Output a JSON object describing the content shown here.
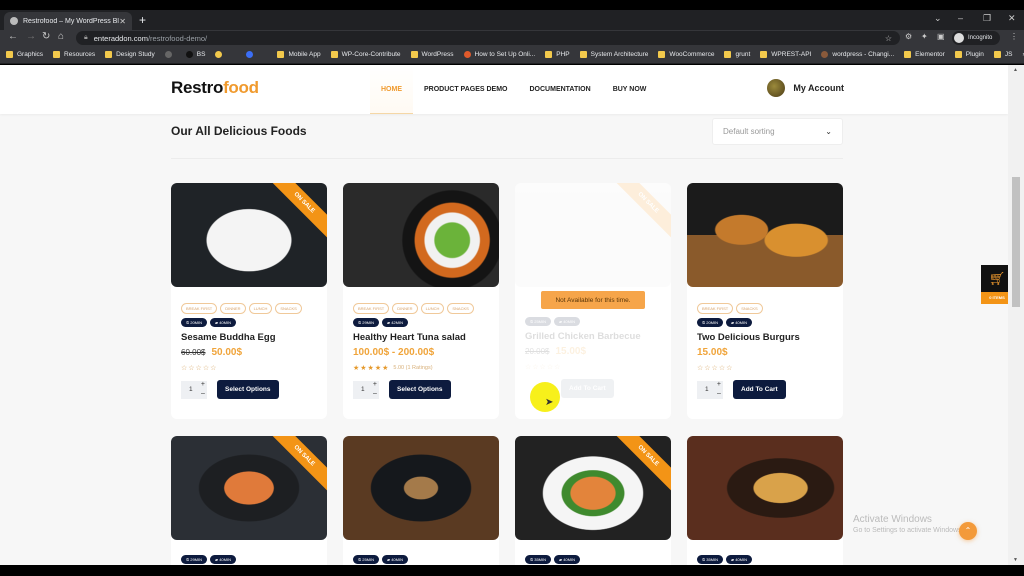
{
  "browser": {
    "tab_title": "Restrofood – My WordPress Blog",
    "url_domain": "enteraddon.com",
    "url_path": "/restrofood-demo/",
    "profile_label": "Incognito",
    "bookmarks": [
      {
        "label": "Graphics",
        "type": "folder"
      },
      {
        "label": "Resources",
        "type": "folder"
      },
      {
        "label": "Design Study",
        "type": "folder"
      },
      {
        "label": "",
        "type": "icon-gray"
      },
      {
        "label": "BS",
        "type": "icon-dark"
      },
      {
        "label": "",
        "type": "icon-yellow"
      },
      {
        "label": "",
        "type": "separator"
      },
      {
        "label": "",
        "type": "icon-blue"
      },
      {
        "label": "",
        "type": "separator"
      },
      {
        "label": "Mobile App",
        "type": "folder"
      },
      {
        "label": "WP-Core-Contribute",
        "type": "folder"
      },
      {
        "label": "WordPress",
        "type": "folder"
      },
      {
        "label": "How to Set Up Onli...",
        "type": "icon-orange"
      },
      {
        "label": "PHP",
        "type": "folder"
      },
      {
        "label": "System Architecture",
        "type": "folder"
      },
      {
        "label": "WooCommerce",
        "type": "folder"
      },
      {
        "label": "grunt",
        "type": "folder"
      },
      {
        "label": "WPREST-API",
        "type": "folder"
      },
      {
        "label": "wordpress - Changi...",
        "type": "icon-brown"
      },
      {
        "label": "Elementor",
        "type": "folder"
      },
      {
        "label": "Plugin",
        "type": "folder"
      },
      {
        "label": "JS",
        "type": "folder"
      }
    ],
    "more_bookmarks": "»"
  },
  "site": {
    "logo_main": "Restro",
    "logo_accent": "food",
    "menu": [
      "HOME",
      "PRODUCT PAGES DEMO",
      "DOCUMENTATION",
      "BUY NOW"
    ],
    "account_label": "My Account",
    "section_title": "Our All Delicious Foods",
    "sort_selected": "Default sorting",
    "accent_color": "#f09a2e",
    "button_color": "#0d1b3e"
  },
  "products": [
    {
      "name": "Sesame Buddha Egg",
      "categories": [
        "BREAK FIRST",
        "DINNER",
        "LUNCH",
        "SNACKS"
      ],
      "times": [
        "20MIN",
        "40MIN"
      ],
      "old_price": "60.00$",
      "price": "50.00$",
      "rating": 0,
      "rating_text": "",
      "qty": "1",
      "button": "Select Options",
      "on_sale": "ON SALE",
      "available": true
    },
    {
      "name": "Healthy Heart Tuna salad",
      "categories": [
        "BREAK FIRST",
        "DINNER",
        "LUNCH",
        "SNACKS"
      ],
      "times": [
        "29MIN",
        "42MIN"
      ],
      "old_price": "",
      "price": "100.00$ - 200.00$",
      "rating": 5,
      "rating_text": "5.00 (1 Ratings)",
      "qty": "1",
      "button": "Select Options",
      "on_sale": "",
      "available": true
    },
    {
      "name": "Grilled Chicken Barbecue",
      "categories": [],
      "times": [
        "25MIN",
        "40MIN"
      ],
      "old_price": "20.00$",
      "price": "15.00$",
      "rating": 0,
      "rating_text": "",
      "qty": "",
      "button": "Add To Cart",
      "on_sale": "ON SALE",
      "available": false,
      "notice": "Not Available for this time."
    },
    {
      "name": "Two Delicious Burgurs",
      "categories": [
        "BREAK FIRST",
        "SNACKS"
      ],
      "times": [
        "20MIN",
        "40MIN"
      ],
      "old_price": "",
      "price": "15.00$",
      "rating": 0,
      "rating_text": "",
      "qty": "1",
      "button": "Add To Cart",
      "on_sale": "",
      "available": true
    }
  ],
  "products_row2": [
    {
      "times": [
        "29MIN",
        "40MIN"
      ],
      "on_sale": "ON SALE"
    },
    {
      "times": [
        "25MIN",
        "40MIN"
      ],
      "on_sale": ""
    },
    {
      "times": [
        "35MIN",
        "40MIN"
      ],
      "on_sale": "ON SALE"
    },
    {
      "times": [
        "35MIN",
        "40MIN"
      ],
      "on_sale": ""
    }
  ],
  "cart": {
    "items_label": "0 ITEMS"
  },
  "watermark": {
    "line1": "Activate Windows",
    "line2": "Go to Settings to activate Windows."
  }
}
